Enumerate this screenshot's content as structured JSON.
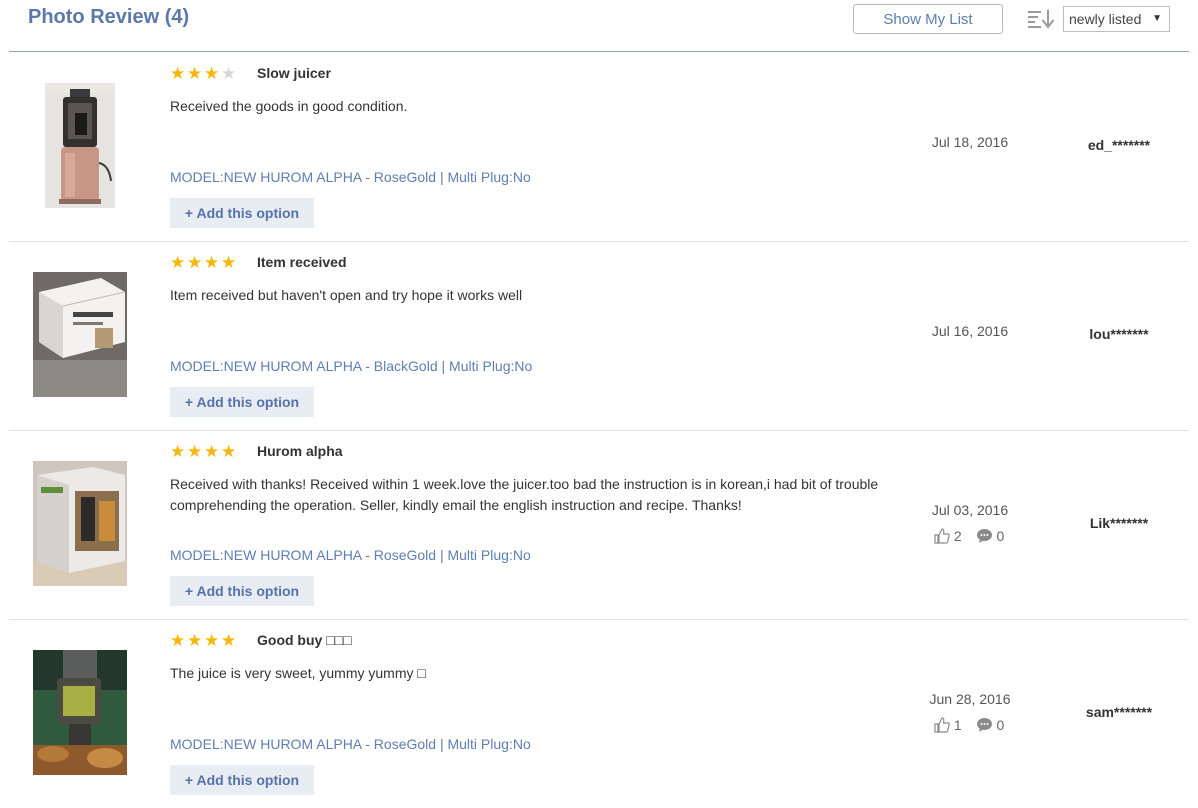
{
  "header": {
    "title": "Photo Review (4)",
    "show_my_list": "Show My List",
    "sort_selected": "newly listed",
    "sort_icon": "sort-descending-icon",
    "dropdown_icon": "caret-down-icon"
  },
  "colors": {
    "accent": "#5a79aa",
    "star": "#f5b70a",
    "option_link": "#5f7eb1",
    "add_button_bg": "#e8edf4"
  },
  "reviews": [
    {
      "rating": 3,
      "max_rating": 5,
      "title": "Slow juicer",
      "body": "Received the goods in good condition.",
      "option": "MODEL:NEW HUROM ALPHA - RoseGold | Multi Plug:No",
      "add_label": "+ Add this option",
      "date": "Jul 18, 2016",
      "user": "ed_*******",
      "photo": "pink juicer"
    },
    {
      "rating": 4,
      "max_rating": 5,
      "title": "Item received",
      "body": "Item received but haven't open and try hope it works well",
      "option": "MODEL:NEW HUROM ALPHA - BlackGold | Multi Plug:No",
      "add_label": "+ Add this option",
      "date": "Jul 16, 2016",
      "user": "lou*******",
      "photo": "product box"
    },
    {
      "rating": 4,
      "max_rating": 5,
      "title": "Hurom alpha",
      "body": "Received with thanks! Received within 1 week.love the juicer.too bad the instruction is in korean,i had bit of trouble comprehending the operation. Seller, kindly email the english instruction and recipe. Thanks!",
      "option": "MODEL:NEW HUROM ALPHA - RoseGold | Multi Plug:No",
      "add_label": "+ Add this option",
      "date": "Jul 03, 2016",
      "likes": "2",
      "comments": "0",
      "user": "Lik*******",
      "photo": "product box"
    },
    {
      "rating": 4,
      "max_rating": 5,
      "title": "Good buy □□□",
      "body": "The juice is very sweet, yummy yummy □",
      "option": "MODEL:NEW HUROM ALPHA - RoseGold | Multi Plug:No",
      "add_label": "+ Add this option",
      "date": "Jun 28, 2016",
      "likes": "1",
      "comments": "0",
      "user": "sam*******",
      "photo": "juicer in use"
    }
  ]
}
